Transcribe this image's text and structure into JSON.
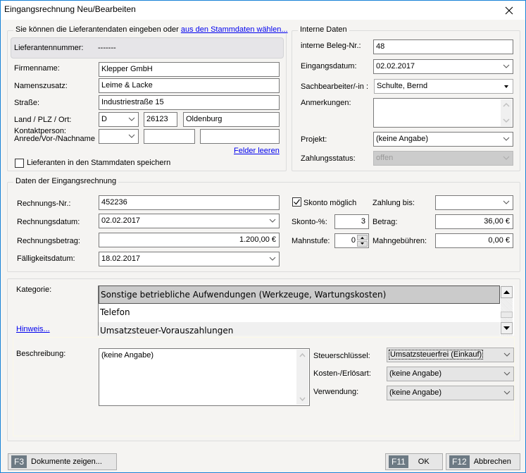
{
  "window": {
    "title": "Eingangsrechnung Neu/Bearbeiten",
    "close_icon": "close-icon"
  },
  "supplier": {
    "legend_text": "Sie können die Lieferantendaten eingeben oder",
    "legend_link": "aus den Stammdaten wählen...",
    "supplier_number_label": "Lieferantennummer:",
    "supplier_number_value": "-------",
    "company_label": "Firmenname:",
    "company_value": "Klepper GmbH",
    "name_suffix_label": "Namenszusatz:",
    "name_suffix_value": "Leime & Lacke",
    "street_label": "Straße:",
    "street_value": "Industriestraße 15",
    "country_zip_city_label": "Land / PLZ / Ort:",
    "country_value": "D",
    "zip_value": "26123",
    "city_value": "Oldenburg",
    "contact_label_line1": "Kontaktperson:",
    "contact_label_line2": "Anrede/Vor-/Nachname",
    "salutation_value": "",
    "firstname_value": "",
    "lastname_value": "",
    "clear_fields_link": "Felder leeren",
    "save_checkbox_label": "Lieferanten in den Stammdaten speichern",
    "save_checkbox_checked": false
  },
  "internal": {
    "legend": "Interne Daten",
    "doc_no_label": "interne Beleg-Nr.:",
    "doc_no_value": "48",
    "receipt_date_label": "Eingangsdatum:",
    "receipt_date_value": "02.02.2017",
    "clerk_label": "Sachbearbeiter/-in :",
    "clerk_value": "Schulte, Bernd",
    "notes_label": "Anmerkungen:",
    "notes_value": "",
    "project_label": "Projekt:",
    "project_value": "(keine Angabe)",
    "payment_status_label": "Zahlungsstatus:",
    "payment_status_value": "offen"
  },
  "invoice": {
    "legend": "Daten der Eingangsrechnung",
    "invoice_no_label": "Rechnungs-Nr.:",
    "invoice_no_value": "452236",
    "invoice_date_label": "Rechnungsdatum:",
    "invoice_date_value": "02.02.2017",
    "amount_label": "Rechnungsbetrag:",
    "amount_value": "1.200,00 €",
    "due_date_label": "Fälligkeitsdatum:",
    "due_date_value": "18.02.2017",
    "discount_checkbox_label": "Skonto möglich",
    "discount_checked": true,
    "discount_pct_label": "Skonto-%:",
    "discount_pct_value": "3",
    "dunning_level_label": "Mahnstufe:",
    "dunning_level_value": "0",
    "pay_by_label": "Zahlung bis:",
    "pay_by_value": "",
    "discount_amount_label": "Betrag:",
    "discount_amount_value": "36,00 €",
    "dunning_fee_label": "Mahngebühren:",
    "dunning_fee_value": "0,00 €"
  },
  "category": {
    "label": "Kategorie:",
    "hint_link": "Hinweis...",
    "items": [
      {
        "label": "Sonstige betriebliche Aufwendungen (Werkzeuge, Wartungskosten)",
        "selected": true
      },
      {
        "label": "Telefon",
        "selected": false
      },
      {
        "label": "Umsatzsteuer-Vorauszahlungen",
        "selected": false
      }
    ]
  },
  "details": {
    "description_label": "Beschreibung:",
    "description_value": "(keine Angabe)",
    "tax_key_label": "Steuerschlüssel:",
    "tax_key_value": "Umsatzsteuerfrei (Einkauf)",
    "cost_type_label": "Kosten-/Erlösart:",
    "cost_type_value": "(keine Angabe)",
    "usage_label": "Verwendung:",
    "usage_value": "(keine Angabe)"
  },
  "footer": {
    "documents_key": "F3",
    "documents_label": "Dokumente zeigen...",
    "ok_key": "F11",
    "ok_label": "OK",
    "cancel_key": "F12",
    "cancel_label": "Abbrechen"
  }
}
